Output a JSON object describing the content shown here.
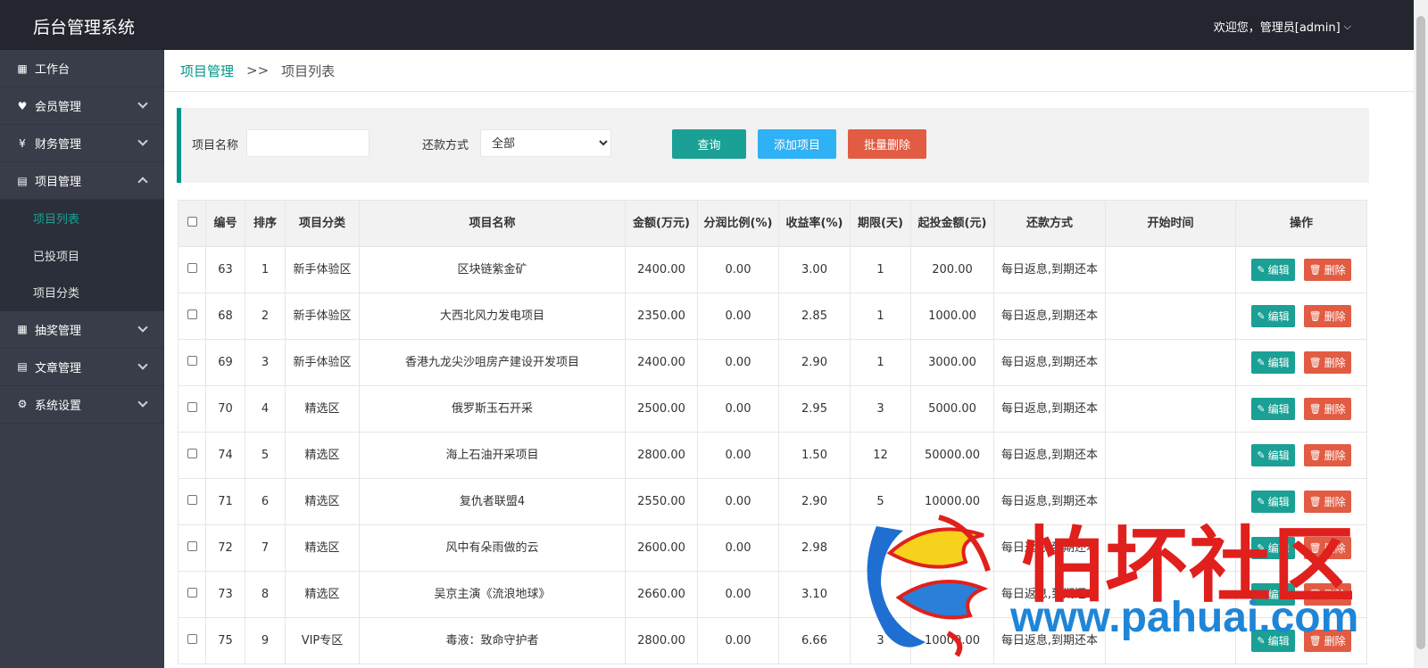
{
  "header": {
    "brand": "后台管理系统",
    "user_greeting": "欢迎您，管理员[admin]"
  },
  "sidebar": {
    "items": [
      {
        "label": "工作台",
        "icon": "dashboard-icon",
        "glyph": "▦",
        "chevron": "none"
      },
      {
        "label": "会员管理",
        "icon": "member-icon",
        "glyph": "♥",
        "chevron": "down"
      },
      {
        "label": "财务管理",
        "icon": "finance-icon",
        "glyph": "¥",
        "chevron": "down"
      },
      {
        "label": "项目管理",
        "icon": "project-icon",
        "glyph": "▤",
        "chevron": "up"
      },
      {
        "label": "抽奖管理",
        "icon": "lottery-icon",
        "glyph": "▦",
        "chevron": "down"
      },
      {
        "label": "文章管理",
        "icon": "article-icon",
        "glyph": "▤",
        "chevron": "down"
      },
      {
        "label": "系统设置",
        "icon": "gear-icon",
        "glyph": "⚙",
        "chevron": "down"
      }
    ],
    "project_sub": [
      "项目列表",
      "已投项目",
      "项目分类"
    ],
    "active_sub": "项目列表"
  },
  "breadcrumb": {
    "parent": "项目管理",
    "separator": ">>",
    "current": "项目列表"
  },
  "filter": {
    "name_label": "项目名称",
    "name_value": "",
    "repay_label": "还款方式",
    "repay_selected": "全部",
    "query_btn": "查询",
    "add_btn": "添加项目",
    "batch_delete_btn": "批量删除"
  },
  "table": {
    "headers": [
      "编号",
      "排序",
      "项目分类",
      "项目名称",
      "金额(万元)",
      "分润比例(%)",
      "收益率(%)",
      "期限(天)",
      "起投金额(元)",
      "还款方式",
      "开始时间",
      "操作"
    ],
    "edit_label": "编辑",
    "delete_label": "删除",
    "rows": [
      {
        "id": "63",
        "sort": "1",
        "category": "新手体验区",
        "name": "区块链紫金矿",
        "amount": "2400.00",
        "share": "0.00",
        "rate": "3.00",
        "term": "1",
        "min": "200.00",
        "repay": "每日返息,到期还本",
        "start": ""
      },
      {
        "id": "68",
        "sort": "2",
        "category": "新手体验区",
        "name": "大西北风力发电项目",
        "amount": "2350.00",
        "share": "0.00",
        "rate": "2.85",
        "term": "1",
        "min": "1000.00",
        "repay": "每日返息,到期还本",
        "start": ""
      },
      {
        "id": "69",
        "sort": "3",
        "category": "新手体验区",
        "name": "香港九龙尖沙咀房产建设开发项目",
        "amount": "2400.00",
        "share": "0.00",
        "rate": "2.90",
        "term": "1",
        "min": "3000.00",
        "repay": "每日返息,到期还本",
        "start": ""
      },
      {
        "id": "70",
        "sort": "4",
        "category": "精选区",
        "name": "俄罗斯玉石开采",
        "amount": "2500.00",
        "share": "0.00",
        "rate": "2.95",
        "term": "3",
        "min": "5000.00",
        "repay": "每日返息,到期还本",
        "start": ""
      },
      {
        "id": "74",
        "sort": "5",
        "category": "精选区",
        "name": "海上石油开采项目",
        "amount": "2800.00",
        "share": "0.00",
        "rate": "1.50",
        "term": "12",
        "min": "50000.00",
        "repay": "每日返息,到期还本",
        "start": ""
      },
      {
        "id": "71",
        "sort": "6",
        "category": "精选区",
        "name": "复仇者联盟4",
        "amount": "2550.00",
        "share": "0.00",
        "rate": "2.90",
        "term": "5",
        "min": "10000.00",
        "repay": "每日返息,到期还本",
        "start": ""
      },
      {
        "id": "72",
        "sort": "7",
        "category": "精选区",
        "name": "风中有朵雨做的云",
        "amount": "2600.00",
        "share": "0.00",
        "rate": "2.98",
        "term": "",
        "min": "",
        "repay": "每日返息,到期还本",
        "start": ""
      },
      {
        "id": "73",
        "sort": "8",
        "category": "精选区",
        "name": "吴京主演《流浪地球》",
        "amount": "2660.00",
        "share": "0.00",
        "rate": "3.10",
        "term": "",
        "min": "",
        "repay": "每日返息,到期还本",
        "start": ""
      },
      {
        "id": "75",
        "sort": "9",
        "category": "VIP专区",
        "name": "毒液：致命守护者",
        "amount": "2800.00",
        "share": "0.00",
        "rate": "6.66",
        "term": "3",
        "min": "10000.00",
        "repay": "每日返息,到期还本",
        "start": ""
      }
    ]
  },
  "watermark": {
    "text": "怕坏社区",
    "url": "www.pahuai.com"
  },
  "colors": {
    "header_bg": "#23262e",
    "sidebar_bg": "#393d49",
    "accent": "#009688",
    "blue": "#2fb1f5",
    "red": "#e15c43"
  }
}
